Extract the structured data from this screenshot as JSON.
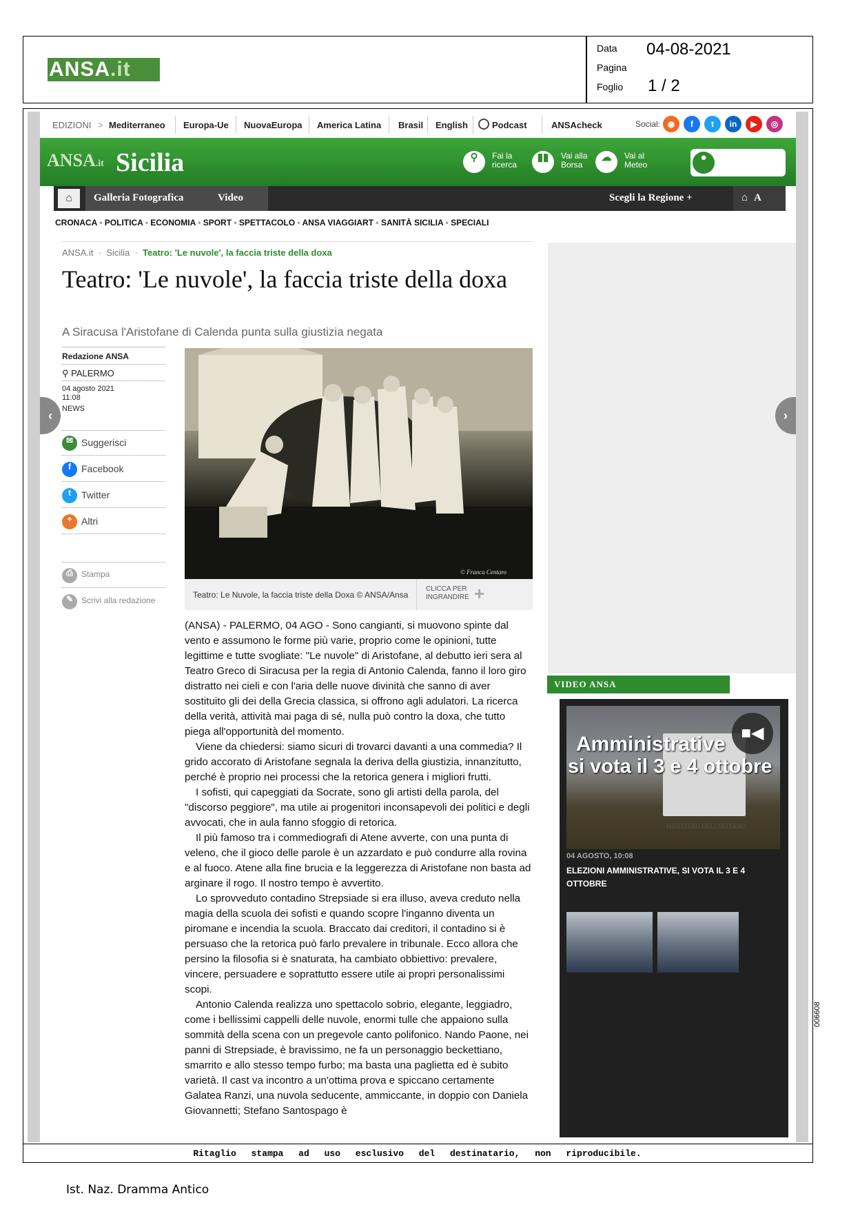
{
  "header": {
    "logo": {
      "main": "ANSA",
      "suffix": "it"
    },
    "meta": {
      "date_label": "Data",
      "date_value": "04-08-2021",
      "page_label": "Pagina",
      "sheet_label": "Foglio",
      "sheet_value": "1 / 2"
    }
  },
  "topnav": {
    "items": [
      "EDIZIONI",
      "Mediterraneo",
      "Europa-Ue",
      "NuovaEuropa",
      "America Latina",
      "Brasil",
      "English",
      "Podcast",
      "ANSAcheck"
    ],
    "social_label": "Social:"
  },
  "greenbar": {
    "logo": "ANSA",
    "logo_suffix": "it",
    "title": "Sicilia",
    "links": [
      {
        "line1": "Fai la",
        "line2": "ricerca",
        "icon": "search-icon"
      },
      {
        "line1": "Vai alla",
        "line2": "Borsa",
        "icon": "chart-icon"
      },
      {
        "line1": "Vai al",
        "line2": "Meteo",
        "icon": "weather-icon"
      }
    ]
  },
  "darkbar": {
    "items": [
      "Galleria Fotografica",
      "Video"
    ],
    "region": "Scegli la Regione +",
    "font_toggle": "A"
  },
  "categories": [
    "CRONACA",
    "POLITICA",
    "ECONOMIA",
    "SPORT",
    "SPETTACOLO",
    "ANSA VIAGGIART",
    "SANITÀ SICILIA",
    "SPECIALI"
  ],
  "breadcrumb": [
    "ANSA.it",
    "Sicilia",
    "Teatro: 'Le nuvole', la faccia triste della doxa"
  ],
  "article": {
    "title": "Teatro: 'Le nuvole', la faccia triste della doxa",
    "subtitle": "A Siracusa l'Aristofane di Calenda punta sulla giustizia negata",
    "author": "Redazione ANSA",
    "location": "PALERMO",
    "date": "04 agosto 2021",
    "time": "11:08",
    "section": "NEWS",
    "share": [
      "Suggerisci",
      "Facebook",
      "Twitter",
      "Altri"
    ],
    "tools": [
      "Stampa",
      "Scrivi alla redazione"
    ],
    "photo_credit": "© Franca Centaro",
    "caption": "Teatro: Le Nuvole, la faccia triste della Doxa © ANSA/Ansa",
    "enlarge": "CLICCA PER INGRANDIRE",
    "paragraphs": [
      "(ANSA) - PALERMO, 04 AGO - Sono cangianti, si muovono spinte dal vento e assumono le forme più varie, proprio come le opinioni, tutte legittime e tutte svogliate: \"Le nuvole\" di Aristofane, al debutto ieri sera al Teatro Greco di Siracusa per la regia di Antonio Calenda, fanno il loro giro distratto nei cieli e con l'aria delle nuove divinità che sanno di aver sostituito gli dei della Grecia classica, si offrono agli adulatori. La ricerca della verità, attività mai paga di sé, nulla può contro la doxa, che tutto piega all'opportunità del momento.",
      "Viene da chiedersi: siamo sicuri di trovarci davanti a una commedia? Il grido accorato di Aristofane segnala la deriva della giustizia, innanzitutto, perché è proprio nei processi che la retorica genera i migliori frutti.",
      "I sofisti, qui capeggiati da Socrate, sono gli artisti della parola, del \"discorso peggiore\", ma utile ai progenitori inconsapevoli dei politici e degli avvocati, che in aula fanno sfoggio di retorica.",
      "Il più famoso tra i commediografi di Atene avverte, con una punta di veleno, che il gioco delle parole è un azzardato e può condurre alla rovina e al fuoco. Atene alla fine brucia e la leggerezza di Aristofane non basta ad arginare il rogo. Il nostro tempo è avvertito.",
      "Lo sprovveduto contadino Strepsiade si era illuso, aveva creduto nella magia della scuola dei sofisti e quando scopre l'inganno diventa un piromane e incendia la scuola. Braccato dai creditori, il contadino si è persuaso che la retorica può farlo prevalere in tribunale. Ecco allora che persino la filosofia si è snaturata, ha cambiato obbiettivo: prevalere, vincere, persuadere e soprattutto essere utile ai propri personalissimi scopi.",
      "Antonio Calenda realizza uno spettacolo sobrio, elegante, leggiadro, come i bellissimi cappelli delle nuvole, enormi tulle che appaiono sulla sommità della scena con un pregevole canto polifonico. Nando Paone, nei panni di Strepsiade, è bravissimo, ne fa un personaggio beckettiano, smarrito e allo stesso tempo furbo; ma basta una paglietta ed è subito varietà. Il cast va incontro a un'ottima prova e spiccano certamente Galatea Ranzi, una nuvola seducente, ammiccante, in doppio con Daniela Giovannetti; Stefano Santospago è"
    ]
  },
  "video": {
    "header": "VIDEO ANSA",
    "thumb_text_line1": "Amministrative",
    "thumb_text_line2": "si vota il 3 e 4 ottobre",
    "box_text": "MINISTERO DELL'INTERNO",
    "date": "04 AGOSTO, 10:08",
    "headline": "ELEZIONI AMMINISTRATIVE, SI VOTA IL 3 E 4 OTTOBRE"
  },
  "footer": {
    "notice": "Ritaglio stampa ad uso esclusivo del destinatario, non riproducibile.",
    "source": "Ist. Naz. Dramma Antico",
    "code": "006608"
  },
  "colors": {
    "brand_green": "#2e8b2e",
    "dark_bar": "#2b2b2b"
  }
}
